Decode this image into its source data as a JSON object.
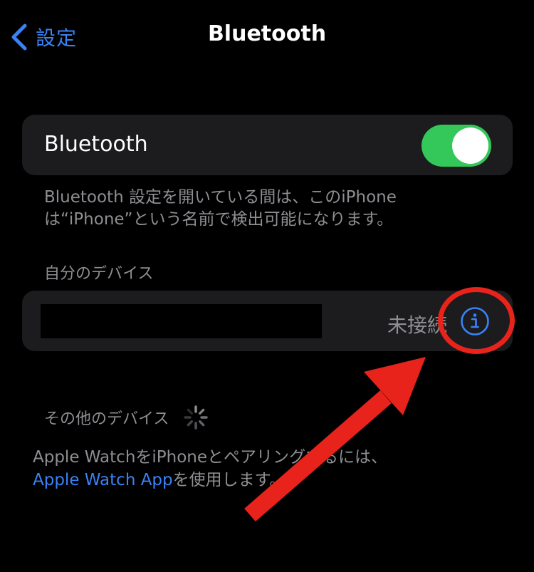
{
  "nav": {
    "back_label": "設定",
    "title": "Bluetooth"
  },
  "bluetooth": {
    "label": "Bluetooth",
    "enabled": true,
    "footnote": "Bluetooth 設定を開いている間は、このiPhoneは“iPhone”という名前で検出可能になります。"
  },
  "my_devices": {
    "header": "自分のデバイス",
    "device": {
      "name": "",
      "status": "未接続"
    }
  },
  "other_devices": {
    "header": "その他のデバイス"
  },
  "watch_hint": {
    "text_before": "Apple WatchをiPhoneとペアリングするには、",
    "link": "Apple Watch App",
    "text_after": "を使用します。"
  },
  "colors": {
    "accent": "#3a82f6",
    "toggle_on": "#34c759",
    "annotation": "#e8231c"
  },
  "icons": {
    "back": "chevron-left-icon",
    "info": "info-circle-icon",
    "spinner": "activity-spinner-icon",
    "annotation": "red-arrow-annotation"
  }
}
